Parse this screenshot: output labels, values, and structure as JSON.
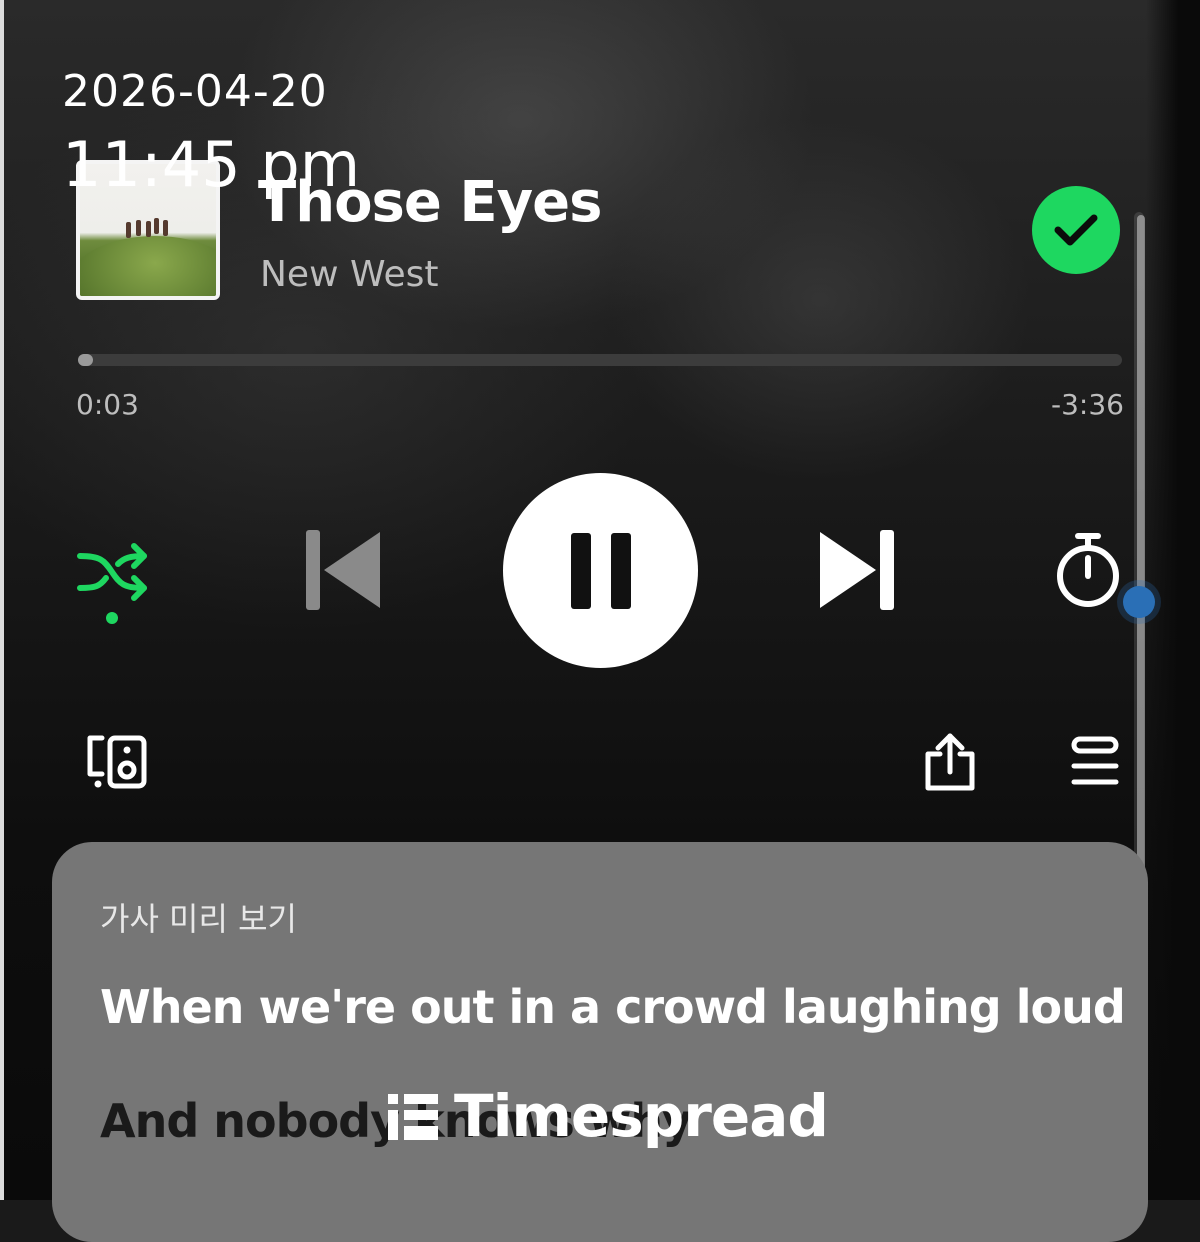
{
  "overlay": {
    "date": "2026-04-20",
    "time": "11:45 pm"
  },
  "now_playing": {
    "title": "Those Eyes",
    "artist": "New West",
    "liked": true,
    "elapsed": "0:03",
    "remaining": "-3:36",
    "progress_fraction": 0.014
  },
  "controls": {
    "shuffle_icon": "shuffle-icon",
    "previous_icon": "skip-previous-icon",
    "pause_icon": "pause-icon",
    "next_icon": "skip-next-icon",
    "timer_icon": "sleep-timer-icon",
    "devices_icon": "connect-devices-icon",
    "share_icon": "share-icon",
    "queue_icon": "queue-icon"
  },
  "lyrics": {
    "title": "가사 미리 보기",
    "lines": [
      "When we're out in a crowd laughing loud",
      "And nobody knows why"
    ]
  },
  "watermark": {
    "text": "Timespread"
  },
  "colors": {
    "accent": "#1ed760",
    "card": "#767676",
    "scroll_handle": "#2a6fb6"
  }
}
